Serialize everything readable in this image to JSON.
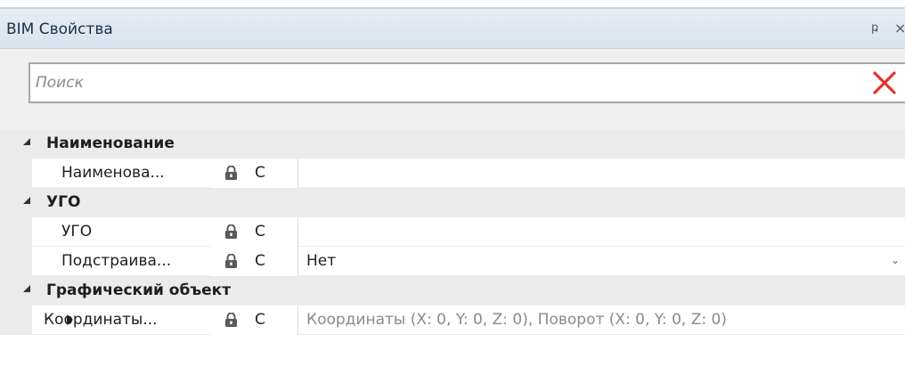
{
  "window": {
    "title": "BIM Свойства",
    "pin_glyph": "ҏ",
    "close_glyph": "×"
  },
  "search": {
    "placeholder": "Поиск",
    "value": "",
    "clear_icon": "close-x-icon",
    "clear_color": "#e0342a"
  },
  "categories": [
    {
      "name": "Наименование",
      "properties": [
        {
          "name": "Наименова...",
          "locked": true,
          "code": "С",
          "value": ""
        }
      ]
    },
    {
      "name": "УГО",
      "properties": [
        {
          "name": "УГО",
          "locked": true,
          "code": "С",
          "value": ""
        },
        {
          "name": "Подстраива...",
          "locked": true,
          "code": "С",
          "value": "Нет",
          "has_dropdown": true
        }
      ]
    },
    {
      "name": "Графический объект",
      "properties": [
        {
          "name": "Координаты...",
          "locked": true,
          "code": "С",
          "value": "Координаты (X: 0, Y: 0, Z: 0), Поворот (X: 0, Y: 0, Z: 0)",
          "expandable": true
        }
      ]
    }
  ],
  "colors": {
    "titlebar": "#dbe6f1",
    "category_bg": "#ebebeb",
    "accent_clear": "#e0342a"
  }
}
